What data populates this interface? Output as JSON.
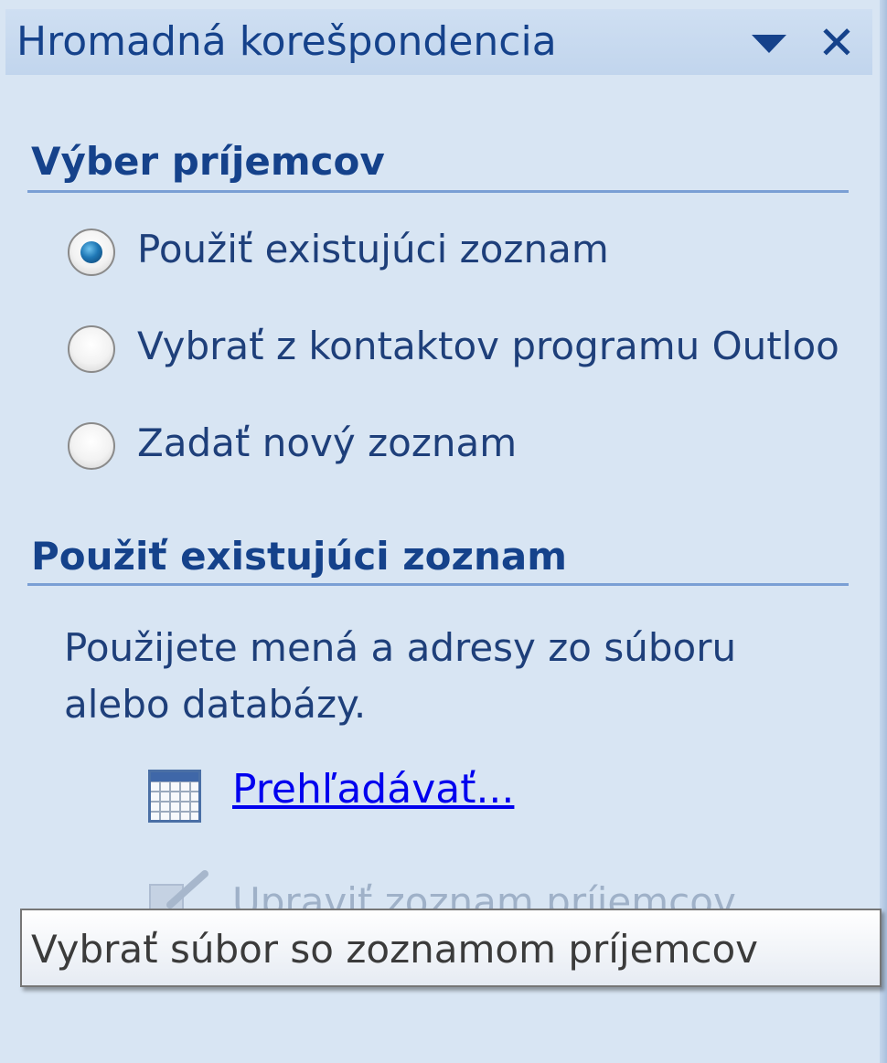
{
  "pane": {
    "title": "Hromadná korešpondencia",
    "menu_icon": "chevron-down-icon",
    "close_icon": "close-icon",
    "close_glyph": "✕"
  },
  "recipients": {
    "heading": "Výber príjemcov",
    "options": [
      {
        "label": "Použiť existujúci zoznam",
        "checked": true
      },
      {
        "label": "Vybrať z kontaktov programu Outloo",
        "checked": false
      },
      {
        "label": "Zadať nový zoznam",
        "checked": false
      }
    ]
  },
  "existing": {
    "heading": "Použiť existujúci zoznam",
    "description": "Použijete mená a adresy zo súboru alebo databázy.",
    "browse_icon": "table-icon",
    "browse_label": "Prehľadávať...",
    "edit_icon": "edit-list-icon",
    "edit_label": "Upraviť zoznam príjemcov..."
  },
  "tooltip": {
    "text": "Vybrať súbor so zoznamom príjemcov"
  },
  "colors": {
    "pane_bg": "#d8e5f3",
    "heading": "#15428b",
    "text": "#1e3f7a",
    "link": "#0000ee"
  }
}
